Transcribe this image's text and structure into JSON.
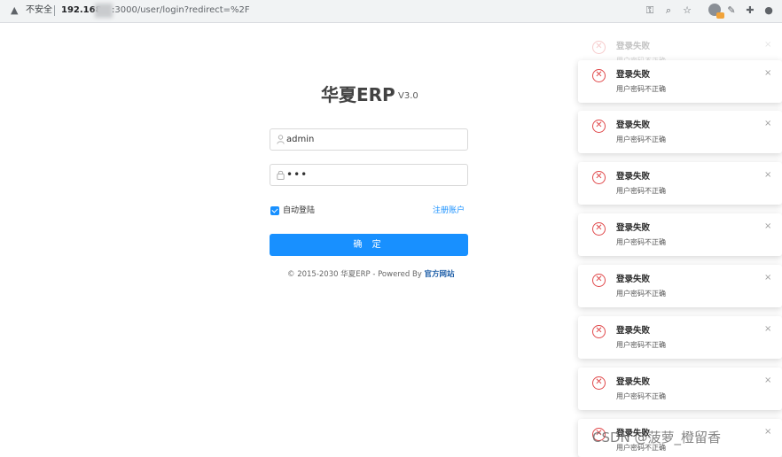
{
  "browser": {
    "security_label": "不安全",
    "url_host": "192.168",
    "url_path": ":3000/user/login?redirect=%2F",
    "icons": [
      "warning-icon",
      "key-icon",
      "zoom-icon",
      "star-icon",
      "extension-badge-icon",
      "pen-icon",
      "puzzle-icon",
      "profile-icon"
    ]
  },
  "login": {
    "title": "华夏ERP",
    "version": "V3.0",
    "username_value": "admin",
    "password_value": "•••",
    "remember_label": "自动登陆",
    "remember_checked": true,
    "register_link": "注册账户",
    "submit_label": "确 定",
    "footer_prefix": "© 2015-2030 华夏ERP - Powered By ",
    "footer_link": "官方网站"
  },
  "notifications": [
    {
      "title": "登录失败",
      "desc": "用户密码不正确",
      "close": "×"
    },
    {
      "title": "登录失败",
      "desc": "用户密码不正确",
      "close": "×"
    },
    {
      "title": "登录失败",
      "desc": "用户密码不正确",
      "close": "×"
    },
    {
      "title": "登录失败",
      "desc": "用户密码不正确",
      "close": "×"
    },
    {
      "title": "登录失败",
      "desc": "用户密码不正确",
      "close": "×"
    },
    {
      "title": "登录失败",
      "desc": "用户密码不正确",
      "close": "×"
    },
    {
      "title": "登录失败",
      "desc": "用户密码不正确",
      "close": "×"
    },
    {
      "title": "登录失败",
      "desc": "用户密码不正确",
      "close": "×"
    },
    {
      "title": "登录失败",
      "desc": "用户密码不正确",
      "close": "×"
    }
  ],
  "watermark": "CSDN @菠萝_橙留香",
  "colors": {
    "primary": "#1890ff",
    "error": "#e0484a"
  }
}
